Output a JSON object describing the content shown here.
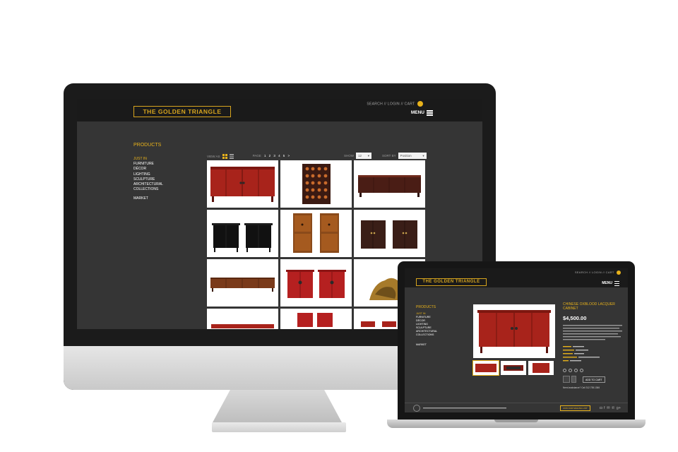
{
  "brand": {
    "name": "THE GOLDEN TRIANGLE",
    "accent": "#e8b21b"
  },
  "header": {
    "search": "SEARCH",
    "login": "LOGIN",
    "cart": "CART",
    "separator": "//",
    "menu": "MENU"
  },
  "sidebar": {
    "title": "PRODUCTS",
    "items": [
      {
        "label": "JUST IN",
        "active": true
      },
      {
        "label": "FURNITURE"
      },
      {
        "label": "DÉCOR"
      },
      {
        "label": "LIGHTING"
      },
      {
        "label": "SCULPTURE"
      },
      {
        "label": "ARCHITECTURAL"
      },
      {
        "label": "COLLECTIONS"
      }
    ],
    "market": "MARKET"
  },
  "toolbar": {
    "view_as": "VIEW AS",
    "page": "PAGE",
    "pages": [
      "1",
      "2",
      "3",
      "4",
      "5",
      ">"
    ],
    "show": "SHOW",
    "show_value": "12",
    "sort_by": "SORT BY",
    "sort_value": "Position"
  },
  "product": {
    "title": "CHINESE OXBLOOD LACQUER CABINET",
    "price": "$4,500.00",
    "add_to_cart": "ADD TO CART",
    "help": "Need assistance? Call 312.755.1366"
  },
  "footer": {
    "mailing": "JOIN OUR MAILING LIST",
    "social_icons": [
      "instagram-icon",
      "facebook-icon",
      "mail-icon",
      "pinterest-icon",
      "google-plus-icon"
    ]
  }
}
